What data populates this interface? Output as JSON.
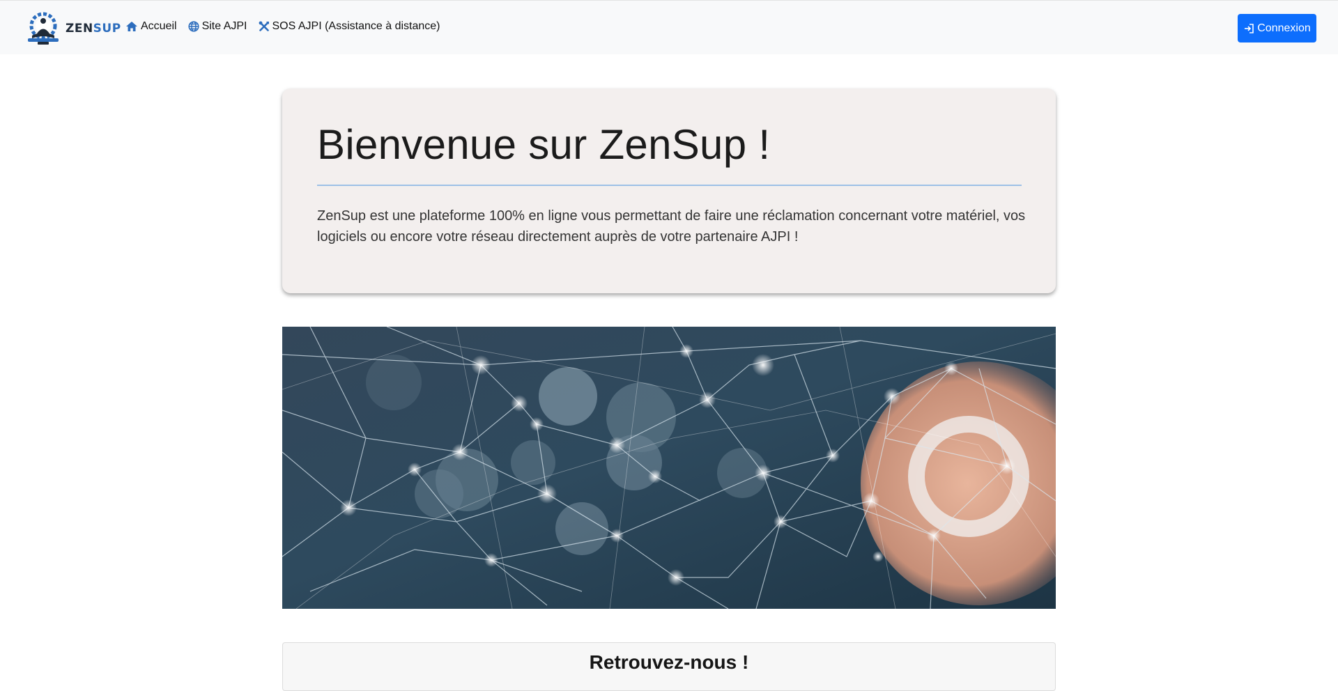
{
  "brand": {
    "name_part1": "ZEN",
    "name_part2": "SUP",
    "colors": {
      "dark": "#1f2a38",
      "accent": "#2c6dbd"
    }
  },
  "nav": {
    "items": [
      {
        "label": "Accueil",
        "icon": "home-icon"
      },
      {
        "label": "Site AJPI",
        "icon": "globe-icon"
      },
      {
        "label": "SOS AJPI (Assistance à distance)",
        "icon": "tools-icon"
      }
    ],
    "login": {
      "label": "Connexion",
      "icon": "login-icon",
      "color": "#0d6efd"
    }
  },
  "hero": {
    "title": "Bienvenue sur ZenSup !",
    "text": "ZenSup est une plateforme 100% en ligne vous permettant de faire une réclamation concernant votre matériel, vos logiciels ou encore votre réseau directement auprès de votre partenaire AJPI !"
  },
  "banner": {
    "description_icon": "network-hand-image"
  },
  "section": {
    "title": "Retrouvez-nous !"
  }
}
